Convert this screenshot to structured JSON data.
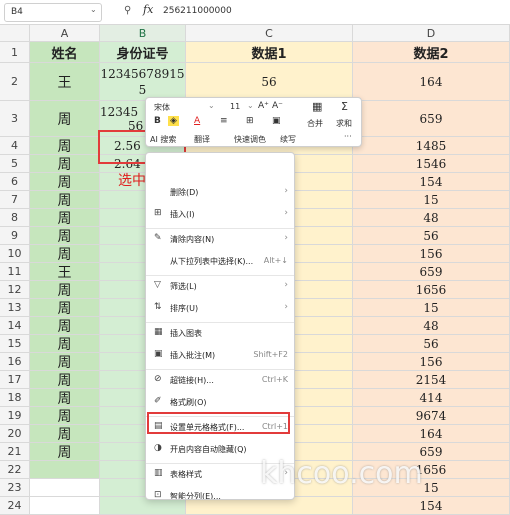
{
  "formula_bar": {
    "name_box": "B4",
    "fx": "fx",
    "value": "256211000000"
  },
  "columns": [
    "A",
    "B",
    "C",
    "D"
  ],
  "headers": {
    "a": "姓名",
    "b": "身份证号",
    "c": "数据1",
    "d": "数据2"
  },
  "rows": [
    {
      "num": "2",
      "name": "王",
      "id": "123456789155",
      "d1": "56",
      "d2": "164"
    },
    {
      "num": "3",
      "name": "周",
      "id": "12345",
      "d1": "",
      "d2": "659"
    },
    {
      "num": "4",
      "name": "周",
      "id": "2.56",
      "d1": "",
      "d2": "1485"
    },
    {
      "num": "5",
      "name": "周",
      "id": "2.64",
      "d1": "",
      "d2": "1546"
    },
    {
      "num": "6",
      "name": "周",
      "id": "",
      "d1": "",
      "d2": "154"
    },
    {
      "num": "7",
      "name": "周",
      "id": "",
      "d1": "",
      "d2": "15"
    },
    {
      "num": "8",
      "name": "周",
      "id": "",
      "d1": "",
      "d2": "48"
    },
    {
      "num": "9",
      "name": "周",
      "id": "",
      "d1": "",
      "d2": "56"
    },
    {
      "num": "10",
      "name": "周",
      "id": "",
      "d1": "",
      "d2": "156"
    },
    {
      "num": "11",
      "name": "王",
      "id": "",
      "d1": "",
      "d2": "659"
    },
    {
      "num": "12",
      "name": "周",
      "id": "",
      "d1": "",
      "d2": "1656"
    },
    {
      "num": "13",
      "name": "周",
      "id": "",
      "d1": "",
      "d2": "15"
    },
    {
      "num": "14",
      "name": "周",
      "id": "",
      "d1": "",
      "d2": "48"
    },
    {
      "num": "15",
      "name": "周",
      "id": "",
      "d1": "",
      "d2": "56"
    },
    {
      "num": "16",
      "name": "周",
      "id": "",
      "d1": "",
      "d2": "156"
    },
    {
      "num": "17",
      "name": "周",
      "id": "",
      "d1": "",
      "d2": "2154"
    },
    {
      "num": "18",
      "name": "周",
      "id": "",
      "d1": "",
      "d2": "414"
    },
    {
      "num": "19",
      "name": "周",
      "id": "",
      "d1": "",
      "d2": "9674"
    },
    {
      "num": "20",
      "name": "周",
      "id": "",
      "d1": "",
      "d2": "164"
    },
    {
      "num": "21",
      "name": "周",
      "id": "",
      "d1": "",
      "d2": "659"
    },
    {
      "num": "22",
      "name": "",
      "id": "",
      "d1": "",
      "d2": "1656"
    },
    {
      "num": "23",
      "name": "",
      "id": "",
      "d1": "",
      "d2": "15"
    },
    {
      "num": "24",
      "name": "",
      "id": "",
      "d1": "",
      "d2": "154"
    }
  ],
  "row1_num": "1",
  "b3_line2": "56",
  "mini_toolbar": {
    "font": "宋体",
    "size": "11",
    "bold": "B",
    "font_color": "A",
    "merge": "合并",
    "sum": "求和",
    "ai": "AI 搜索",
    "translate": "翻译",
    "quick_color": "快速调色",
    "continue": "续写",
    "more": "···",
    "increase": "A⁺",
    "decrease": "A⁻"
  },
  "context_menu": [
    {
      "icon": "",
      "label": "删除(D)",
      "shortcut": "",
      "arrow": "›"
    },
    {
      "icon": "⊞",
      "label": "插入(I)",
      "shortcut": "",
      "arrow": "›"
    },
    {
      "icon": "✎",
      "label": "清除内容(N)",
      "shortcut": "",
      "arrow": "›"
    },
    {
      "icon": "",
      "label": "从下拉列表中选择(K)...",
      "shortcut": "Alt+↓",
      "arrow": ""
    },
    {
      "icon": "▽",
      "label": "筛选(L)",
      "shortcut": "",
      "arrow": "›"
    },
    {
      "icon": "⇅",
      "label": "排序(U)",
      "shortcut": "",
      "arrow": "›"
    },
    {
      "icon": "▦",
      "label": "插入图表",
      "shortcut": "",
      "arrow": ""
    },
    {
      "icon": "▣",
      "label": "插入批注(M)",
      "shortcut": "Shift+F2",
      "arrow": ""
    },
    {
      "icon": "⊘",
      "label": "超链接(H)...",
      "shortcut": "Ctrl+K",
      "arrow": ""
    },
    {
      "icon": "✐",
      "label": "格式刷(O)",
      "shortcut": "",
      "arrow": ""
    },
    {
      "icon": "▤",
      "label": "设置单元格格式(F)...",
      "shortcut": "Ctrl+1",
      "arrow": ""
    },
    {
      "icon": "◑",
      "label": "开启内容自动隐藏(Q)",
      "shortcut": "",
      "arrow": ""
    },
    {
      "icon": "▥",
      "label": "表格样式",
      "shortcut": "",
      "arrow": "›"
    },
    {
      "icon": "⊡",
      "label": "智能分列(E)...",
      "shortcut": "",
      "arrow": ""
    }
  ],
  "annotation": "选中要调整格式的单元格",
  "watermark": "khcoo.com",
  "colors": {
    "col_a": "#c6e6bd",
    "col_b": "#d4eed3",
    "col_c": "#fff2cc",
    "col_d": "#fde6d2",
    "highlight": "#e23b3b"
  }
}
